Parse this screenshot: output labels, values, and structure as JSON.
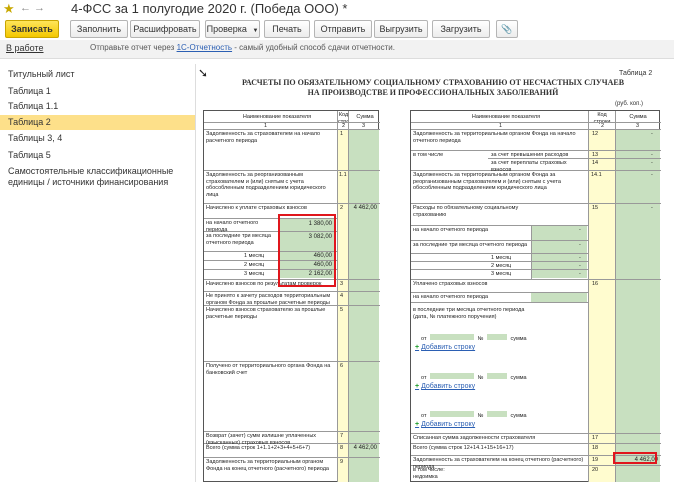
{
  "window": {
    "title": "4-ФСС за 1 полугодие 2020 г. (Победа ООО) *"
  },
  "toolbar": {
    "record": "Записать",
    "fill": "Заполнить",
    "decode": "Расшифровать",
    "check": "Проверка",
    "print": "Печать",
    "send": "Отправить",
    "upload": "Выгрузить",
    "download": "Загрузить"
  },
  "infobar": {
    "status": "В работе",
    "msg_pre": "Отправьте отчет через ",
    "msg_link": "1С-Отчетность",
    "msg_post": " - самый удобный способ сдачи отчетности."
  },
  "sidebar": {
    "items": [
      {
        "label": "Титульный лист"
      },
      {
        "label": "Таблица 1"
      },
      {
        "label": "Таблица 1.1"
      },
      {
        "label": "Таблица 2"
      },
      {
        "label": "Таблицы 3, 4"
      },
      {
        "label": "Таблица 5"
      },
      {
        "label": "Самостоятельные классификационные единицы / источники финансирования"
      }
    ],
    "active_index": 3
  },
  "doc": {
    "table_number": "Таблица 2",
    "heading_line1": "РАСЧЕТЫ ПО ОБЯЗАТЕЛЬНОМУ СОЦИАЛЬНОМУ СТРАХОВАНИЮ ОТ НЕСЧАСТНЫХ СЛУЧАЕВ",
    "heading_line2": "НА ПРОИЗВОДСТВЕ И ПРОФЕССИОНАЛЬНЫХ ЗАБОЛЕВАНИЙ",
    "units": "(руб. коп.)",
    "col_name": "Наименование показателя",
    "col_code": "Код строки",
    "col_sum": "Сумма",
    "idx1": "1",
    "idx2": "2",
    "idx3": "3",
    "left": {
      "r1": "Задолженность за страхователем на начало расчетного периода",
      "r1_1": "Задолженность за реорганизованным страхователем и (или) снятым с учета обособленным подразделением юридического лица",
      "r2": "Начислено к уплате страховых взносов",
      "r2_start": "на начало отчетного периода",
      "r2_last3": "за последние три месяца отчетного периода",
      "m1": "1 месяц",
      "m2": "2 месяц",
      "m3": "3 месяц",
      "r3": "Начислено взносов по результатам проверок",
      "r4": "Не принято к зачету расходов территориальным органом Фонда за прошлые расчетные периоды",
      "r5": "Начислено взносов страхователю за прошлые расчетные периоды",
      "r6": "Получено от территориального органа Фонда на банковский счет",
      "r7": "Возврат (зачет) сумм излишне уплаченных (взысканных) страховых взносов",
      "r8": "Всего (сумма строк 1+1.1+2+3+4+5+6+7)",
      "r9": "Задолженность за территориальным органом Фонда на конец отчетного (расчетного) периода",
      "code1": "1",
      "code1_1": "1.1",
      "code2": "2",
      "code3": "3",
      "code4": "4",
      "code5": "5",
      "code6": "6",
      "code7": "7",
      "code8": "8",
      "code9": "9",
      "sum2": "4 462,00",
      "sum8": "4 462,00",
      "v_start": "1 380,00",
      "v_last3": "3 082,00",
      "v_m1": "460,00",
      "v_m2": "460,00",
      "v_m3": "2 162,00"
    },
    "right": {
      "r12": "Задолженность за территориальным органом Фонда на начало отчетного периода",
      "r13_label": "в том числе",
      "r13": "за счет превышения расходов",
      "r14": "за счет переплаты страховых взносов",
      "r14_1": "Задолженность за территориальным органом Фонда за реорганизованным страхователем и (или) снятым с учета обособленным подразделением юридического лица",
      "r15": "Расходы по обязательному социальному страхованию",
      "r15_start": "на начало отчетного периода",
      "r15_last3": "за последние три месяца отчетного периода",
      "m1": "1 месяц",
      "m2": "2 месяц",
      "m3": "3 месяц",
      "r16": "Уплачено страховых взносов",
      "r16_start": "на начало отчетного периода",
      "r16_last3": "в последние три месяца отчетного периода (дата, № платежного поручения)",
      "pay_from": "от",
      "pay_no": "№",
      "pay_sum": "сумма",
      "add_row": "Добавить строку",
      "r17": "Списанная сумма задолженности страхователя",
      "r18": "Всего (сумма строк 12+14.1+15+16+17)",
      "r19": "Задолженность за страхователем на конец отчетного (расчетного) периода",
      "r20_label": "в том числе:",
      "r20": "недоимка",
      "code12": "12",
      "code13": "13",
      "code14": "14",
      "code14_1": "14.1",
      "code15": "15",
      "code16": "16",
      "code17": "17",
      "code18": "18",
      "code19": "19",
      "code20": "20",
      "dash": "-",
      "sum19": "4 462,00"
    }
  }
}
